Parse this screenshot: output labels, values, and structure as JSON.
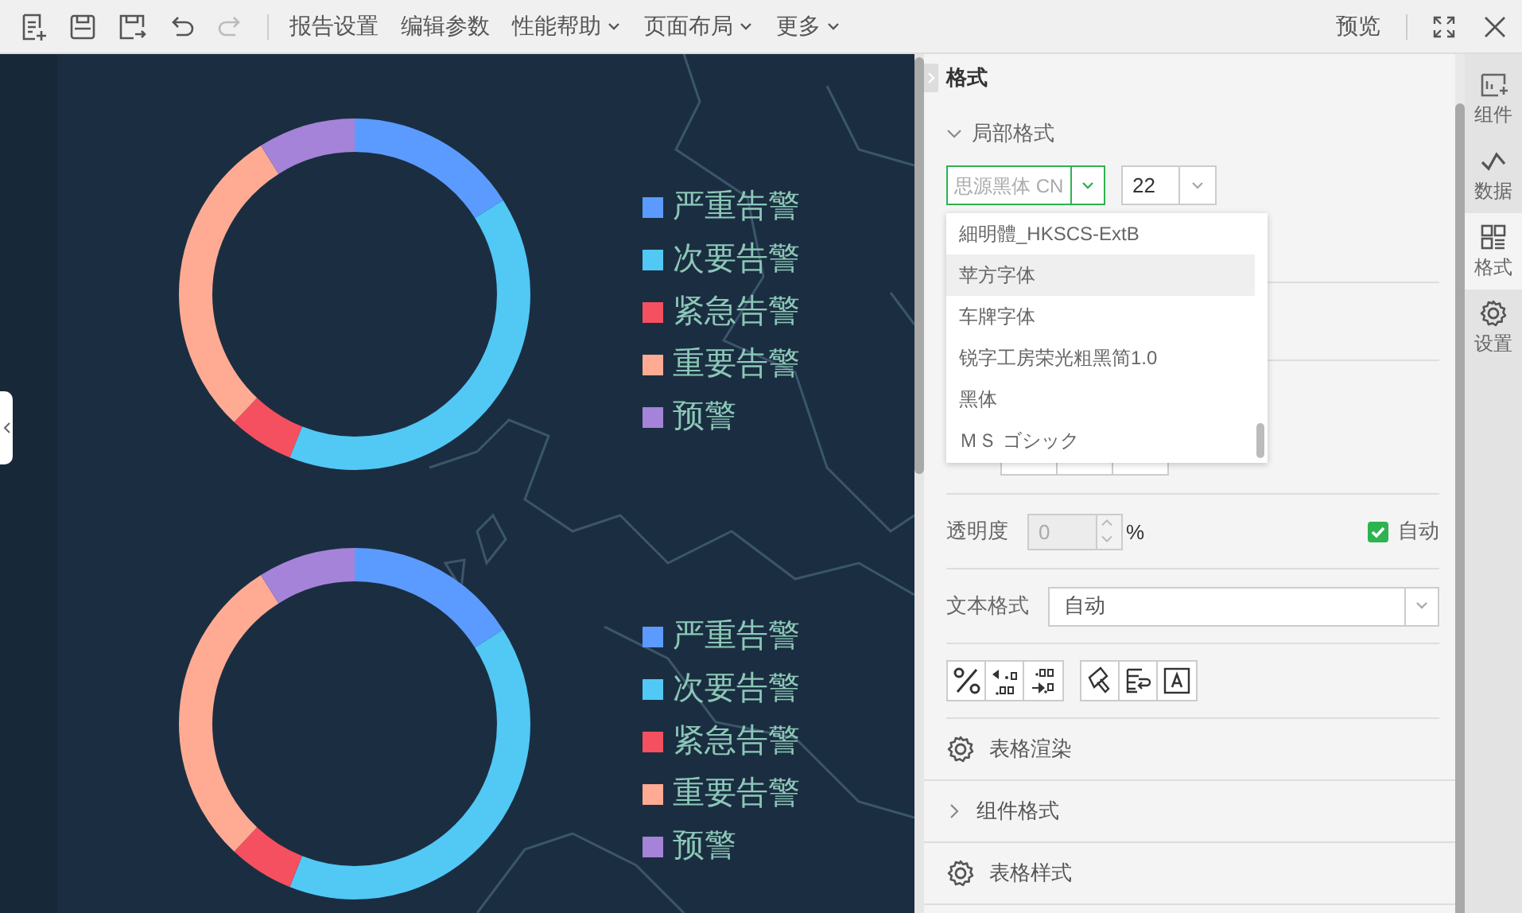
{
  "toolbar": {
    "menus": [
      {
        "label": "报告设置",
        "has_menu": false
      },
      {
        "label": "编辑参数",
        "has_menu": false
      },
      {
        "label": "性能帮助",
        "has_menu": true
      },
      {
        "label": "页面布局",
        "has_menu": true
      },
      {
        "label": "更多",
        "has_menu": true
      }
    ],
    "preview": "预览"
  },
  "canvas": {
    "charts": [
      {
        "legend": [
          {
            "label": "严重告警",
            "color": "#5b9bff"
          },
          {
            "label": "次要告警",
            "color": "#52c8f5"
          },
          {
            "label": "紧急告警",
            "color": "#f5505f"
          },
          {
            "label": "重要告警",
            "color": "#ffab94"
          },
          {
            "label": "预警",
            "color": "#a583d9"
          }
        ]
      },
      {
        "legend": [
          {
            "label": "严重告警",
            "color": "#5b9bff"
          },
          {
            "label": "次要告警",
            "color": "#52c8f5"
          },
          {
            "label": "紧急告警",
            "color": "#f5505f"
          },
          {
            "label": "重要告警",
            "color": "#ffab94"
          },
          {
            "label": "预警",
            "color": "#a583d9"
          }
        ]
      }
    ]
  },
  "panel": {
    "title": "格式",
    "section": {
      "label": "局部格式",
      "expanded": true
    },
    "font_field": {
      "placeholder": "思源黑体 CN",
      "focused": true
    },
    "size_field": {
      "value": "22"
    },
    "font_list": [
      {
        "label": "細明體_HKSCS-ExtB",
        "selected": false
      },
      {
        "label": "苹方字体",
        "selected": true
      },
      {
        "label": "车牌字体",
        "selected": false
      },
      {
        "label": "锐字工房荣光粗黑简1.0",
        "selected": false
      },
      {
        "label": "黑体",
        "selected": false
      },
      {
        "label": "ＭＳ ゴシック",
        "selected": false
      }
    ],
    "opacity": {
      "label": "透明度",
      "value": "0",
      "disabled": true,
      "unit": "%",
      "auto": {
        "label": "自动",
        "checked": true
      }
    },
    "text_format": {
      "label": "文本格式",
      "value": "自动"
    },
    "sections": [
      {
        "kind": "gear",
        "label": "表格渲染"
      },
      {
        "kind": "chevron",
        "label": "组件格式",
        "expanded": false
      },
      {
        "kind": "gear",
        "label": "表格样式"
      }
    ]
  },
  "side_tabs": [
    {
      "label": "组件",
      "selected": false
    },
    {
      "label": "数据",
      "selected": false
    },
    {
      "label": "格式",
      "selected": true
    },
    {
      "label": "设置",
      "selected": false
    }
  ]
}
